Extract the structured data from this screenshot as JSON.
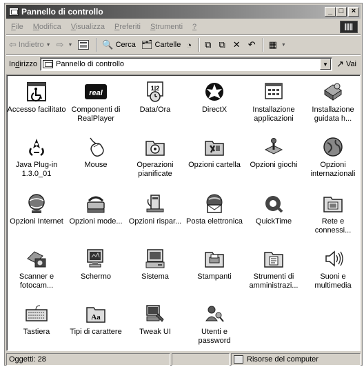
{
  "window": {
    "title": "Pannello di controllo",
    "buttons": {
      "minimize": "_",
      "maximize": "□",
      "close": "×"
    }
  },
  "menu": [
    {
      "label": "File",
      "u": "F",
      "rest": "ile"
    },
    {
      "label": "Modifica",
      "u": "M",
      "rest": "odifica"
    },
    {
      "label": "Visualizza",
      "u": "V",
      "rest": "isualizza"
    },
    {
      "label": "Preferiti",
      "u": "P",
      "rest": "referiti"
    },
    {
      "label": "Strumenti",
      "u": "S",
      "rest": "trumenti"
    },
    {
      "label": "?",
      "u": "?",
      "rest": ""
    }
  ],
  "toolbar": {
    "back": "Indietro",
    "search": "Cerca",
    "folders": "Cartelle"
  },
  "address": {
    "label_pre": "In",
    "label_u": "d",
    "label_post": "irizzo",
    "value": "Pannello di controllo",
    "go": "Vai"
  },
  "icons": [
    {
      "label": "Accesso facilitato",
      "icon": "accessibility-icon"
    },
    {
      "label": "Componenti di RealPlayer",
      "icon": "realplayer-icon"
    },
    {
      "label": "Data/Ora",
      "icon": "calendar-clock-icon"
    },
    {
      "label": "DirectX",
      "icon": "directx-icon"
    },
    {
      "label": "Installazione applicazioni",
      "icon": "add-remove-programs-icon"
    },
    {
      "label": "Installazione guidata h...",
      "icon": "add-hardware-icon"
    },
    {
      "label": "Java Plug-in 1.3.0_01",
      "icon": "java-icon"
    },
    {
      "label": "Mouse",
      "icon": "mouse-icon"
    },
    {
      "label": "Operazioni pianificate",
      "icon": "scheduled-tasks-icon"
    },
    {
      "label": "Opzioni cartella",
      "icon": "folder-options-icon"
    },
    {
      "label": "Opzioni giochi",
      "icon": "joystick-icon"
    },
    {
      "label": "Opzioni internazionali",
      "icon": "globe-icon"
    },
    {
      "label": "Opzioni Internet",
      "icon": "internet-options-icon"
    },
    {
      "label": "Opzioni mode...",
      "icon": "modem-icon"
    },
    {
      "label": "Opzioni rispar...",
      "icon": "power-options-icon"
    },
    {
      "label": "Posta elettronica",
      "icon": "mail-icon"
    },
    {
      "label": "QuickTime",
      "icon": "quicktime-icon"
    },
    {
      "label": "Rete e connessi...",
      "icon": "network-icon"
    },
    {
      "label": "Scanner e fotocam...",
      "icon": "scanner-camera-icon"
    },
    {
      "label": "Schermo",
      "icon": "display-icon"
    },
    {
      "label": "Sistema",
      "icon": "system-icon"
    },
    {
      "label": "Stampanti",
      "icon": "printers-icon"
    },
    {
      "label": "Strumenti di amministrazi...",
      "icon": "admin-tools-icon"
    },
    {
      "label": "Suoni e multimedia",
      "icon": "sounds-icon"
    },
    {
      "label": "Tastiera",
      "icon": "keyboard-icon"
    },
    {
      "label": "Tipi di carattere",
      "icon": "fonts-icon"
    },
    {
      "label": "Tweak UI",
      "icon": "tweakui-icon"
    },
    {
      "label": "Utenti e password",
      "icon": "users-icon"
    }
  ],
  "status": {
    "count": "Oggetti: 28",
    "zone": "Risorse del computer"
  }
}
